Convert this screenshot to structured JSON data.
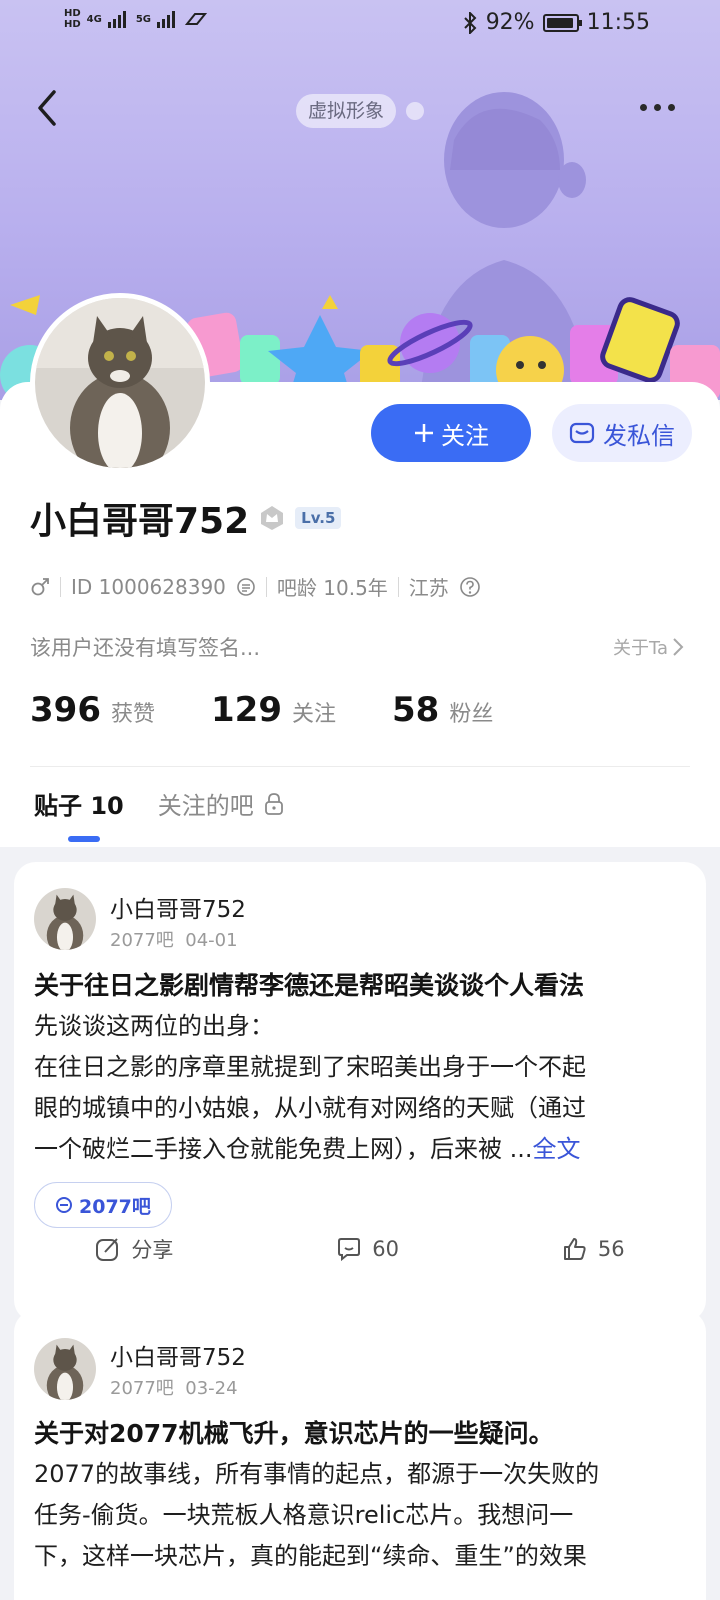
{
  "status_bar": {
    "battery": "92%",
    "time": "11:55",
    "network_1": "4G",
    "network_2": "5G"
  },
  "header": {
    "avatar_chip": "虚拟形象"
  },
  "profile": {
    "username": "小白哥哥752",
    "level": "Lv.5",
    "gender": "male",
    "id_text": "ID 1000628390",
    "tieba_age": "吧龄 10.5年",
    "location": "江苏",
    "signature": "该用户还没有填写签名...",
    "about_label": "关于Ta",
    "follow_button": "关注",
    "message_button": "发私信",
    "stats": [
      {
        "value": "396",
        "label": "获赞"
      },
      {
        "value": "129",
        "label": "关注"
      },
      {
        "value": "58",
        "label": "粉丝"
      }
    ]
  },
  "tabs": {
    "posts": "贴子 10",
    "followed_bars": "关注的吧"
  },
  "posts": [
    {
      "author": "小白哥哥752",
      "forum": "2077吧",
      "date": "04-01",
      "title": "关于往日之影剧情帮李德还是帮昭美谈谈个人看法",
      "body_line1": "先谈谈这两位的出身：",
      "body_line2": "在往日之影的序章里就提到了宋昭美出身于一个不起",
      "body_line3": "眼的城镇中的小姑娘，从小就有对网络的天赋（通过",
      "body_line4": "一个破烂二手接入仓就能免费上网），后来被 ...",
      "full_text_label": "全文",
      "tag": "2077吧",
      "share_label": "分享",
      "comments": "60",
      "likes": "56"
    },
    {
      "author": "小白哥哥752",
      "forum": "2077吧",
      "date": "03-24",
      "title": "关于对2077机械飞升，意识芯片的一些疑问。",
      "body_line1": "2077的故事线，所有事情的起点，都源于一次失败的",
      "body_line2": "任务-偷货。一块荒板人格意识relic芯片。我想问一",
      "body_line3": "下，这样一块芯片，真的能起到“续命、重生”的效果"
    }
  ],
  "colors": {
    "accent": "#3a6cf4",
    "header_bg": "#b9b0ee",
    "page_bg": "#f1f2f6"
  }
}
